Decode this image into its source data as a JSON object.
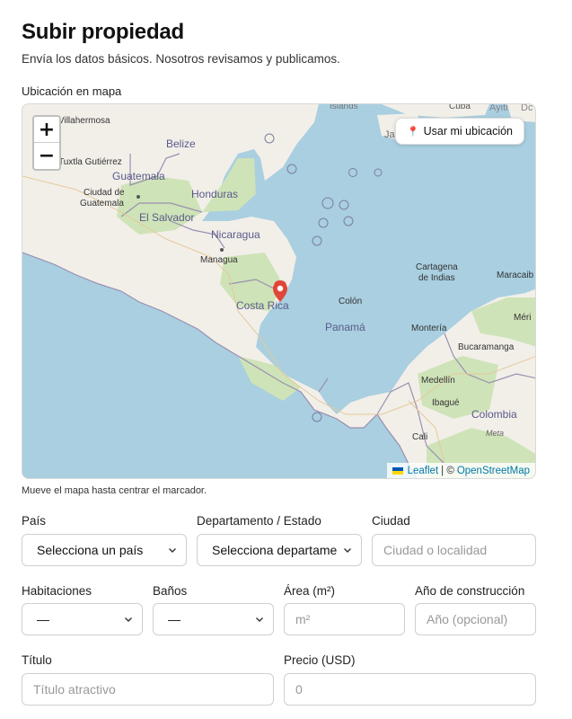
{
  "page": {
    "title": "Subir propiedad",
    "subtitle": "Envía los datos básicos. Nosotros revisamos y publicamos.",
    "map_label": "Ubicación en mapa",
    "map_hint": "Mueve el mapa hasta centrar el marcador."
  },
  "map": {
    "zoom_in": "+",
    "zoom_out": "−",
    "locate_label": "Usar mi ubicación",
    "attribution": {
      "leaflet": "Leaflet",
      "separator": "| ©",
      "osm": "OpenStreetMap"
    },
    "places": {
      "islands": "Islands",
      "villahermosa": "Villahermosa",
      "tuxtla": "Tuxtla Gutiérrez",
      "belize": "Belize",
      "guatemala": "Guatemala",
      "ciudad_guatemala_1": "Ciudad de",
      "ciudad_guatemala_2": "Guatemala",
      "honduras": "Honduras",
      "el_salvador": "El Salvador",
      "nicaragua": "Nicaragua",
      "managua": "Managua",
      "costa_rica": "Costa Rica",
      "colon": "Colón",
      "panama": "Panamá",
      "cartagena_1": "Cartagena",
      "cartagena_2": "de Indias",
      "maracaibo": "Maracaib",
      "monteria": "Montería",
      "merida": "Méri",
      "bucaramanga": "Bucaramanga",
      "medellin": "Medellín",
      "ibague": "Ibagué",
      "colombia": "Colombia",
      "meta": "Meta",
      "cali": "Cali",
      "jar": "Jar",
      "ayiti": "Ayiti",
      "cuba": "Cuba",
      "dc": "Dc"
    }
  },
  "form": {
    "pais": {
      "label": "País",
      "value": "Selecciona un país"
    },
    "departamento": {
      "label": "Departamento / Estado",
      "value": "Selecciona departame"
    },
    "ciudad": {
      "label": "Ciudad",
      "placeholder": "Ciudad o localidad"
    },
    "habitaciones": {
      "label": "Habitaciones",
      "value": "—"
    },
    "banos": {
      "label": "Baños",
      "value": "—"
    },
    "area": {
      "label": "Área (m²)",
      "placeholder": "m²"
    },
    "anio": {
      "label": "Año de construcción",
      "placeholder": "Año (opcional)"
    },
    "titulo": {
      "label": "Título",
      "placeholder": "Título atractivo"
    },
    "precio": {
      "label": "Precio (USD)",
      "placeholder": "0"
    }
  },
  "colors": {
    "water": "#a9cfe0",
    "land": "#f2efe9",
    "forest": "#cfe3b8",
    "border": "#9a8fb0",
    "marker": "#e0453a",
    "link": "#0078a8"
  }
}
